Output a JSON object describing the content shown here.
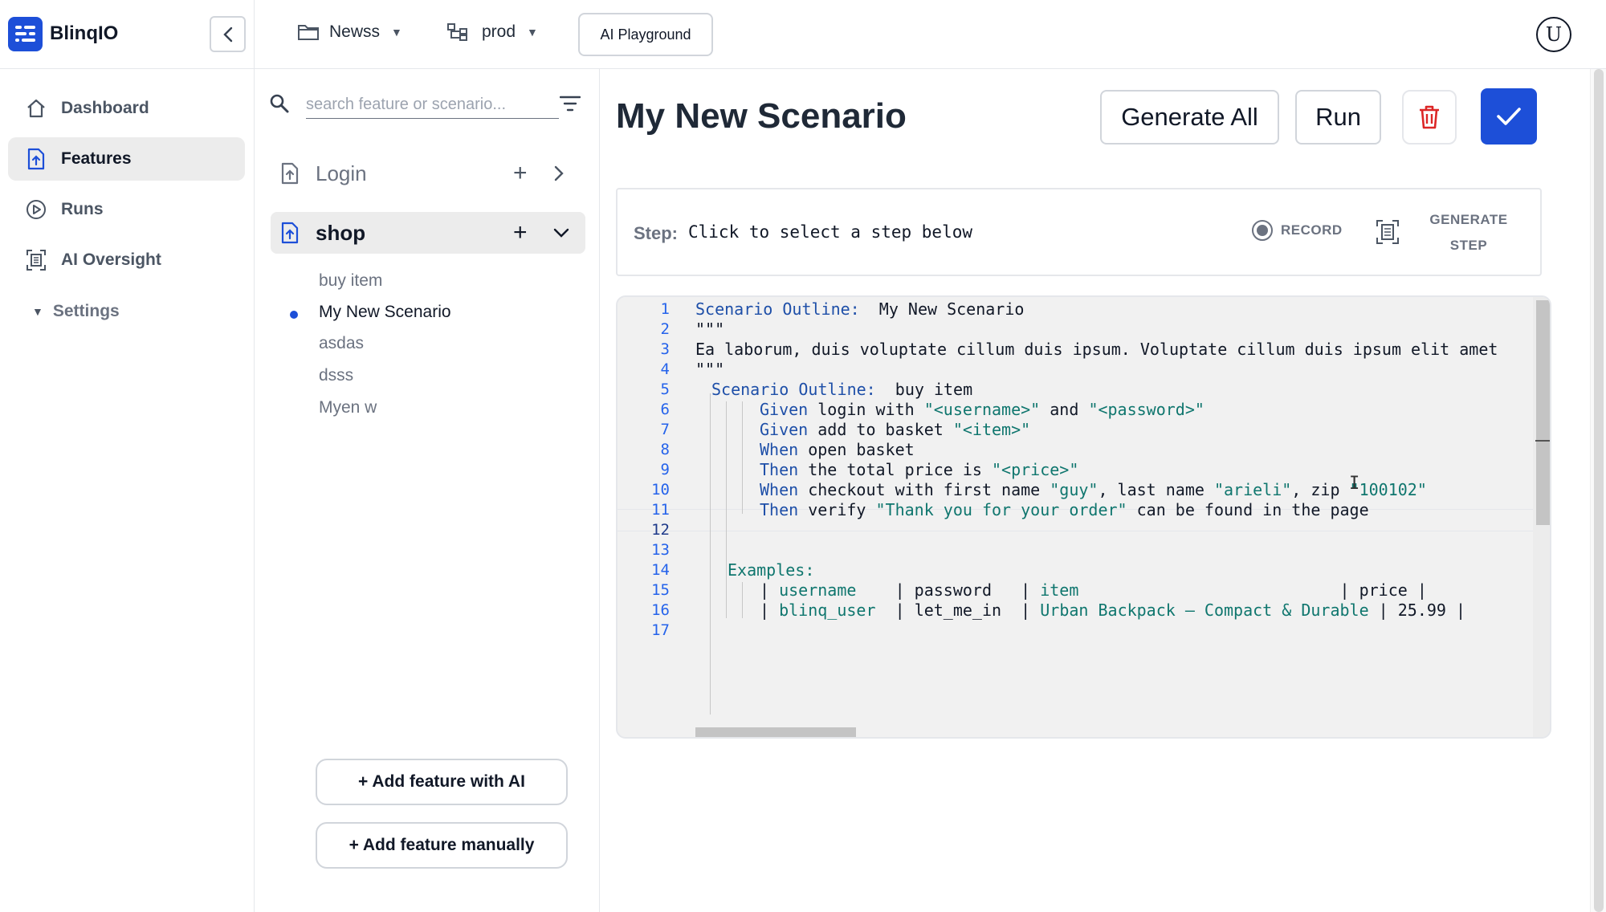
{
  "app": {
    "brand": "BlinqIO"
  },
  "topbar": {
    "project": "Newss",
    "environment": "prod",
    "playground_label": "AI Playground",
    "avatar_letter": "U"
  },
  "nav": {
    "items": [
      {
        "label": "Dashboard",
        "icon": "home-icon",
        "active": false
      },
      {
        "label": "Features",
        "icon": "feature-file-icon",
        "active": true
      },
      {
        "label": "Runs",
        "icon": "play-circle-icon",
        "active": false
      },
      {
        "label": "AI Oversight",
        "icon": "scan-icon",
        "active": false
      }
    ],
    "settings_label": "Settings"
  },
  "features": {
    "search_placeholder": "search feature or scenario...",
    "list": [
      {
        "name": "Login",
        "expanded": false
      },
      {
        "name": "shop",
        "expanded": true
      }
    ],
    "scenarios": [
      "buy item",
      "My New Scenario",
      "asdas",
      "dsss",
      "Myen w"
    ],
    "selected_scenario": "My New Scenario",
    "add_ai_label": "+ Add feature with AI",
    "add_manual_label": "+ Add feature manually"
  },
  "main": {
    "title": "My New Scenario",
    "generate_all_label": "Generate All",
    "run_label": "Run",
    "step_label": "Step:",
    "step_text": "Click to select a step below",
    "record_label": "RECORD",
    "generate_step_line1": "GENERATE",
    "generate_step_line2": "STEP"
  },
  "editor": {
    "current_line": 12,
    "line_numbers": [
      "1",
      "2",
      "3",
      "4",
      "5",
      "6",
      "7",
      "8",
      "9",
      "10",
      "11",
      "12",
      "13",
      "14",
      "15",
      "16",
      "17"
    ],
    "lines": {
      "l1_kw": "Scenario Outline:",
      "l1_txt": "  My New Scenario",
      "l2": "\"\"\"",
      "l3": "Ea laborum, duis voluptate cillum duis ipsum. Voluptate cillum duis ipsum elit amet",
      "l4": "\"\"\"",
      "l5_kw": "Scenario Outline:",
      "l5_txt": "  buy item",
      "l6_kw": "Given",
      "l6_a": " login with ",
      "l6_s1": "\"<username>\"",
      "l6_b": " and ",
      "l6_s2": "\"<password>\"",
      "l7_kw": "Given",
      "l7_a": " add to basket ",
      "l7_s1": "\"<item>\"",
      "l8_kw": "When",
      "l8_a": " open basket",
      "l9_kw": "Then",
      "l9_a": " the total price is ",
      "l9_s1": "\"<price>\"",
      "l10_kw": "When",
      "l10_a": " checkout with first name ",
      "l10_s1": "\"guy\"",
      "l10_b": ", last name ",
      "l10_s2": "\"arieli\"",
      "l10_c": ", zip ",
      "l10_s3": "\"100102\"",
      "l11_kw": "Then",
      "l11_a": " verify ",
      "l11_s1": "\"Thank you for your order\"",
      "l11_b": " can be found in the page",
      "l14_kw": "Examples:",
      "l15_p1": "| ",
      "l15_c1": "username",
      "l15_p2": "    | ",
      "l15_c2": "password",
      "l15_p3": "   | ",
      "l15_c3": "item",
      "l15_p4": "                           | ",
      "l15_c4": "price",
      "l15_p5": " |",
      "l16_p1": "| ",
      "l16_c1": "blinq_user",
      "l16_p2": "  | ",
      "l16_c2": "let_me_in",
      "l16_p3": "  | ",
      "l16_c3": "Urban Backpack – Compact & Durable",
      "l16_p4": " | ",
      "l16_c4": "25.99",
      "l16_p5": " |"
    }
  },
  "colors": {
    "accent": "#1d4fd8",
    "keyword": "#1e4fa8",
    "string": "#0f766e",
    "danger": "#dc2626"
  }
}
